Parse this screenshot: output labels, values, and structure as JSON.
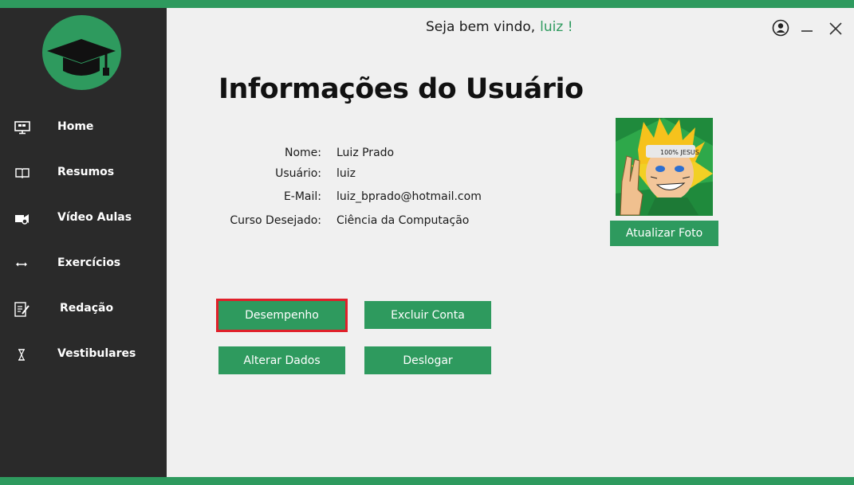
{
  "header": {
    "welcome_text": "Seja bem vindo,",
    "username": "luiz !"
  },
  "sidebar": {
    "items": [
      {
        "label": "Home",
        "icon": "monitor-icon"
      },
      {
        "label": "Resumos",
        "icon": "book-icon"
      },
      {
        "label": "Vídeo Aulas",
        "icon": "video-camera-icon"
      },
      {
        "label": "Exercícios",
        "icon": "arrows-icon"
      },
      {
        "label": "Redação",
        "icon": "edit-document-icon"
      },
      {
        "label": "Vestibulares",
        "icon": "hourglass-icon"
      }
    ]
  },
  "main": {
    "title": "Informações do Usuário",
    "fields": [
      {
        "label": "Nome:",
        "value": "Luiz Prado"
      },
      {
        "label": "Usuário:",
        "value": "luiz"
      },
      {
        "label": "E-Mail:",
        "value": "luiz_bprado@hotmail.com"
      },
      {
        "label": "Curso Desejado:",
        "value": "Ciência da Computação"
      }
    ],
    "photo_caption": "100% JESUS",
    "update_photo_label": "Atualizar Foto",
    "buttons": {
      "performance": "Desempenho",
      "delete_account": "Excluir Conta",
      "edit_data": "Alterar Dados",
      "logout": "Deslogar"
    }
  },
  "colors": {
    "accent": "#2e9a5e",
    "sidebar_bg": "#2a2a2a",
    "content_bg": "#f0f0f0",
    "selection_border": "#e0202a"
  }
}
